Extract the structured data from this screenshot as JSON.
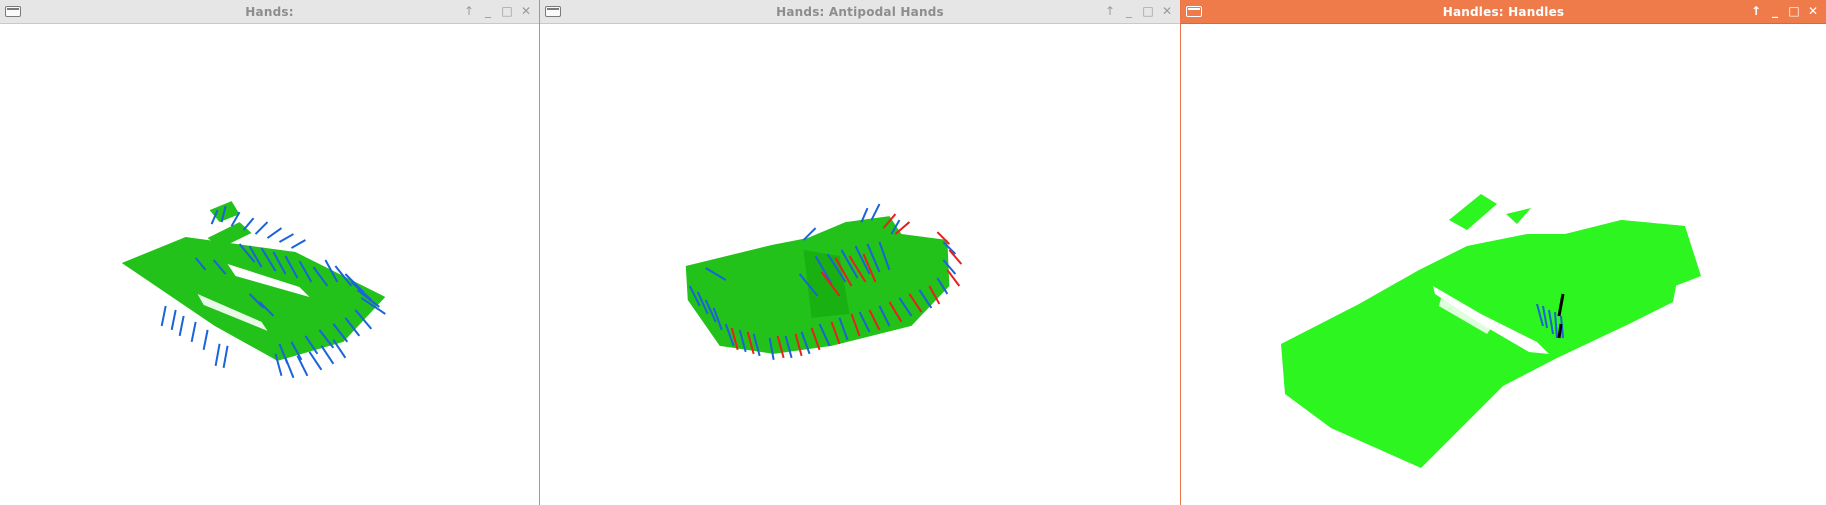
{
  "windows": [
    {
      "id": "w1",
      "title": "Hands:",
      "controls": {
        "raise": "↑",
        "minimize": "_",
        "maximize": "□",
        "close": "✕"
      }
    },
    {
      "id": "w2",
      "title": "Hands: Antipodal Hands",
      "controls": {
        "raise": "↑",
        "minimize": "_",
        "maximize": "□",
        "close": "✕"
      }
    },
    {
      "id": "w3",
      "title": "Handles: Handles",
      "active": true,
      "controls": {
        "raise": "↑",
        "minimize": "_",
        "maximize": "□",
        "close": "✕"
      }
    }
  ],
  "colors": {
    "point_cloud_dark": "#22c21a",
    "point_cloud_bright": "#2df51f",
    "hand_blue": "#1a63d8",
    "hand_red": "#e8201e",
    "handle_black": "#000000",
    "active_titlebar": "#ef7b4a"
  }
}
